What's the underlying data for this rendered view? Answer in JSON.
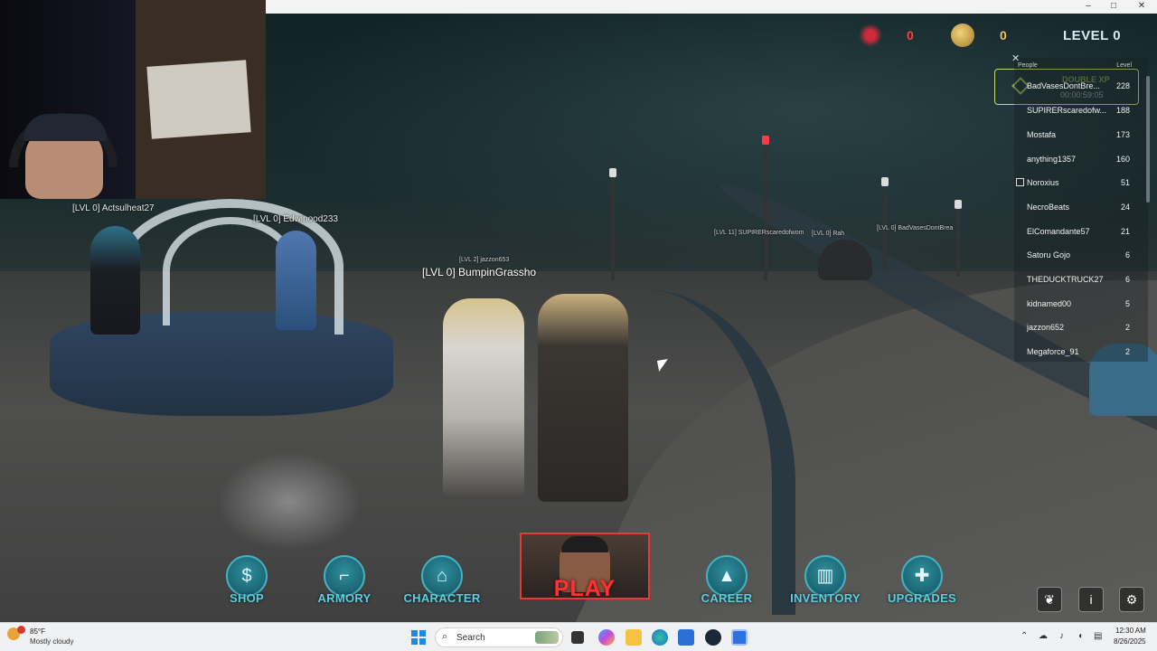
{
  "window": {
    "minimize": "–",
    "maximize": "□",
    "close": "✕"
  },
  "hud": {
    "kills_icon": "blood-splatter-icon",
    "kills": "0",
    "coin_icon": "coin-icon",
    "coins": "0",
    "level": "LEVEL 0"
  },
  "nametags": {
    "actsulheat": "[LVL 0] Actsulheat27",
    "edwinood": "[LVL 0] Edwinood233",
    "bumpin": "[LVL 0] BumpinGrassho",
    "jazzon": "[LVL 2] jazzon653",
    "distant_1": "[LVL 11] SUPIRERscaredofwom",
    "distant_2": "[LVL 0] Rah",
    "distant_3": "[LVL 0] BadVasesDontBrea"
  },
  "player_list": {
    "header_people": "People",
    "header_level": "Level",
    "close": "✕",
    "double_xp": {
      "label": "DOUBLE XP",
      "timer": "00:00:59:05"
    },
    "players": [
      {
        "name": "BadVasesDontBre...",
        "level": "228"
      },
      {
        "name": "SUPIRERscaredofw...",
        "level": "188"
      },
      {
        "name": "Mostafa",
        "level": "173"
      },
      {
        "name": "anything1357",
        "level": "160"
      },
      {
        "name": "Noroxius",
        "level": "51"
      },
      {
        "name": "NecroBeats",
        "level": "24"
      },
      {
        "name": "ElComandante57",
        "level": "21"
      },
      {
        "name": "Satoru Gojo",
        "level": "6"
      },
      {
        "name": "THEDUCKTRUCK27",
        "level": "6"
      },
      {
        "name": "kidnamed00",
        "level": "5"
      },
      {
        "name": "jazzon652",
        "level": "2"
      },
      {
        "name": "Megaforce_91",
        "level": "2"
      }
    ]
  },
  "menu": {
    "shop": {
      "label": "SHOP",
      "icon": "dollar-icon",
      "glyph": "$"
    },
    "armory": {
      "label": "ARMORY",
      "icon": "pistol-icon",
      "glyph": "⌐"
    },
    "character": {
      "label": "CHARACTER",
      "icon": "hanger-icon",
      "glyph": "⌂"
    },
    "play": {
      "label": "PLAY"
    },
    "career": {
      "label": "CAREER",
      "icon": "graduation-cap-icon",
      "glyph": "▲"
    },
    "inventory": {
      "label": "INVENTORY",
      "icon": "locker-icon",
      "glyph": "▥"
    },
    "upgrades": {
      "label": "UPGRADES",
      "icon": "upgrade-plus-icon",
      "glyph": "✚"
    }
  },
  "side_buttons": {
    "twitter": "twitter-icon",
    "info_glyph": "i",
    "settings_glyph": "⚙"
  },
  "taskbar": {
    "weather_temp": "85°F",
    "weather_desc": "Mostly cloudy",
    "search_placeholder": "Search",
    "time": "12:30 AM",
    "date": "8/26/2025"
  },
  "colors": {
    "accent_cyan": "#5ad0e0",
    "play_red": "#ff3030",
    "kills_red": "#ff4040",
    "coin_gold": "#f0c060"
  }
}
